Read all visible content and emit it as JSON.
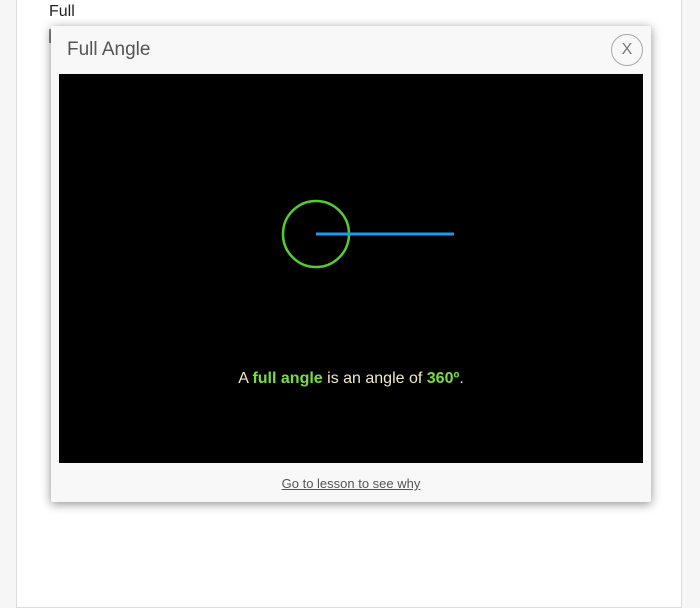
{
  "background": {
    "word": "Full"
  },
  "modal": {
    "title": "Full Angle",
    "close_label": "X",
    "caption": {
      "prefix": "A ",
      "term": "full angle",
      "middle": " is an angle of ",
      "value": "360º",
      "suffix": "."
    },
    "link_label": "Go to lesson to see why"
  },
  "colors": {
    "stage_background": "#000000",
    "arc": "#55cc33",
    "ray": "#2299ee",
    "highlight_text": "#77dd44",
    "caption_text": "#f0e8c8"
  },
  "icons": {
    "close": "close-icon"
  }
}
